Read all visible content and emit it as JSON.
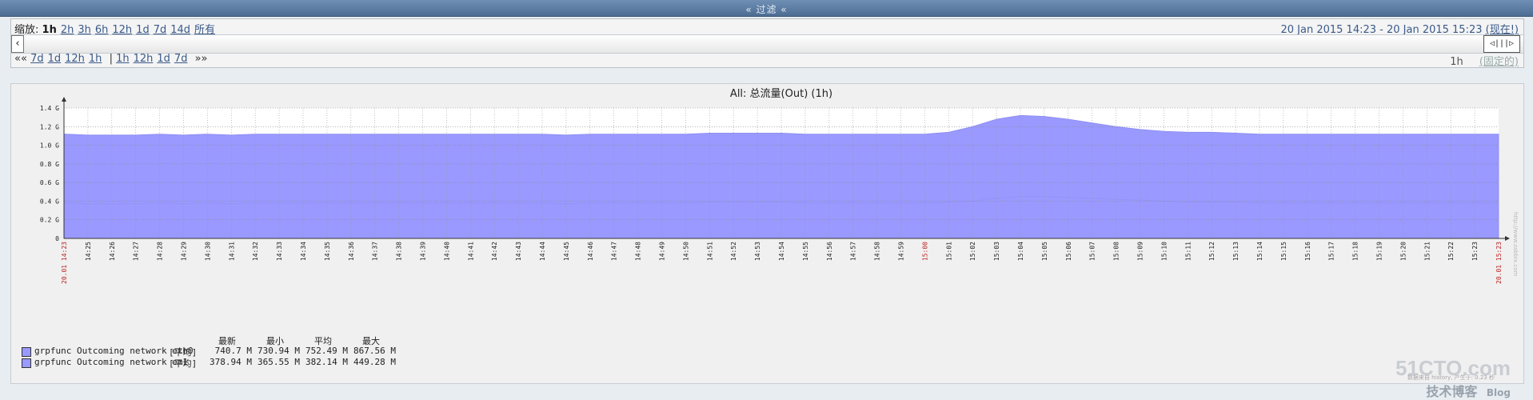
{
  "filter": {
    "label": "« 过滤 «"
  },
  "zoom": {
    "label": "缩放:",
    "options": [
      "1h",
      "2h",
      "3h",
      "6h",
      "12h",
      "1d",
      "7d",
      "14d",
      "所有"
    ],
    "active": "1h"
  },
  "range": {
    "text": "20 Jan 2015 14:23  -  20 Jan 2015 15:23",
    "now_label": "(现在!)"
  },
  "scroll": {
    "left_arrow": "‹",
    "handle": "◁|||▷"
  },
  "nav": {
    "back_prefix": "««",
    "back": [
      "7d",
      "1d",
      "12h",
      "1h"
    ],
    "separator": "|",
    "forward": [
      "1h",
      "12h",
      "1d",
      "7d"
    ],
    "forward_suffix": "»»"
  },
  "period": {
    "value": "1h",
    "fixed_label": "(固定的)"
  },
  "chart_data": {
    "type": "area",
    "title": "All: 总流量(Out) (1h)",
    "ylim": [
      0,
      1.4
    ],
    "y_ticks": [
      "0",
      "0.2 G",
      "0.4 G",
      "0.6 G",
      "0.8 G",
      "1.0 G",
      "1.2 G",
      "1.4 G"
    ],
    "x_start_label": "20.01 14:23",
    "x_end_label": "20.01 15:23",
    "x_highlight": "15:00",
    "x_ticks": [
      "14:25",
      "14:26",
      "14:27",
      "14:28",
      "14:29",
      "14:30",
      "14:31",
      "14:32",
      "14:33",
      "14:34",
      "14:35",
      "14:36",
      "14:37",
      "14:38",
      "14:39",
      "14:40",
      "14:41",
      "14:42",
      "14:43",
      "14:44",
      "14:45",
      "14:46",
      "14:47",
      "14:48",
      "14:49",
      "14:50",
      "14:51",
      "14:52",
      "14:53",
      "14:54",
      "14:55",
      "14:56",
      "14:57",
      "14:58",
      "14:59",
      "15:00",
      "15:01",
      "15:02",
      "15:03",
      "15:04",
      "15:05",
      "15:06",
      "15:07",
      "15:08",
      "15:09",
      "15:10",
      "15:11",
      "15:12",
      "15:13",
      "15:14",
      "15:15",
      "15:16",
      "15:17",
      "15:18",
      "15:19",
      "15:20",
      "15:21",
      "15:22",
      "15:23"
    ],
    "grid": true,
    "stacked": true,
    "series": [
      {
        "name": "grpfunc Outcoming network eth0",
        "color": "#9999ff",
        "values": [
          0.74,
          0.74,
          0.74,
          0.74,
          0.74,
          0.74,
          0.74,
          0.74,
          0.74,
          0.74,
          0.74,
          0.74,
          0.74,
          0.74,
          0.74,
          0.74,
          0.74,
          0.74,
          0.74,
          0.74,
          0.74,
          0.74,
          0.74,
          0.74,
          0.74,
          0.74,
          0.74,
          0.74,
          0.74,
          0.74,
          0.74,
          0.74,
          0.74,
          0.74,
          0.74,
          0.74,
          0.74,
          0.75,
          0.8,
          0.85,
          0.87,
          0.86,
          0.84,
          0.81,
          0.78,
          0.76,
          0.75,
          0.75,
          0.75,
          0.74,
          0.74,
          0.74,
          0.74,
          0.74,
          0.74,
          0.74,
          0.74,
          0.74,
          0.74,
          0.74,
          0.74
        ]
      },
      {
        "name": "grpfunc Outcoming network em1",
        "color": "#9999ff",
        "values": [
          0.38,
          0.37,
          0.37,
          0.37,
          0.38,
          0.37,
          0.38,
          0.37,
          0.38,
          0.38,
          0.38,
          0.38,
          0.38,
          0.38,
          0.38,
          0.38,
          0.38,
          0.38,
          0.38,
          0.38,
          0.38,
          0.37,
          0.38,
          0.38,
          0.38,
          0.38,
          0.38,
          0.39,
          0.39,
          0.39,
          0.39,
          0.38,
          0.38,
          0.38,
          0.38,
          0.38,
          0.38,
          0.39,
          0.4,
          0.43,
          0.45,
          0.45,
          0.44,
          0.43,
          0.42,
          0.41,
          0.4,
          0.39,
          0.39,
          0.39,
          0.38,
          0.38,
          0.38,
          0.38,
          0.38,
          0.38,
          0.38,
          0.38,
          0.38,
          0.38,
          0.38
        ]
      }
    ]
  },
  "legend": {
    "headers": [
      "最新",
      "最小",
      "平均",
      "最大"
    ],
    "rows": [
      {
        "name": "grpfunc Outcoming network eth0",
        "func": "[平均]",
        "last": "740.7 M",
        "min": "730.94 M",
        "avg": "752.49 M",
        "max": "867.56 M"
      },
      {
        "name": "grpfunc Outcoming network em1",
        "func": "[平均]",
        "last": "378.94 M",
        "min": "365.55 M",
        "avg": "382.14 M",
        "max": "449.28 M"
      }
    ]
  },
  "watermark": {
    "big": "51CTO.com",
    "small": "技术博客",
    "blog": "Blog"
  },
  "footer_note": "数据来自 history, 产生于: 0.23 秒",
  "side_note": "http://www.zabbix.com"
}
